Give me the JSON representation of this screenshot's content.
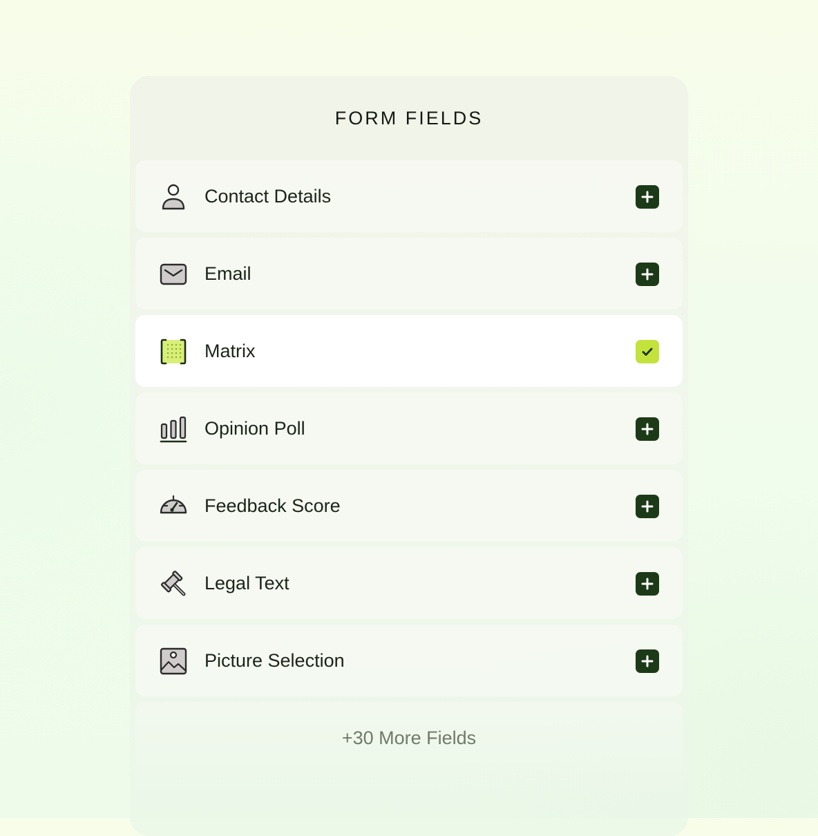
{
  "panel": {
    "title": "FORM FIELDS",
    "fields": [
      {
        "label": "Contact Details",
        "icon": "person-icon",
        "state": "add"
      },
      {
        "label": "Email",
        "icon": "envelope-icon",
        "state": "add"
      },
      {
        "label": "Matrix",
        "icon": "matrix-grid-icon",
        "state": "checked"
      },
      {
        "label": "Opinion Poll",
        "icon": "bar-chart-icon",
        "state": "add"
      },
      {
        "label": "Feedback Score",
        "icon": "gauge-icon",
        "state": "add"
      },
      {
        "label": "Legal Text",
        "icon": "gavel-icon",
        "state": "add"
      },
      {
        "label": "Picture Selection",
        "icon": "picture-icon",
        "state": "add"
      }
    ],
    "more_label": "+30 More Fields"
  },
  "colors": {
    "add_button": "#1c3a17",
    "checked_button": "#c3e23c",
    "accent_light": "#d9ef7a"
  }
}
